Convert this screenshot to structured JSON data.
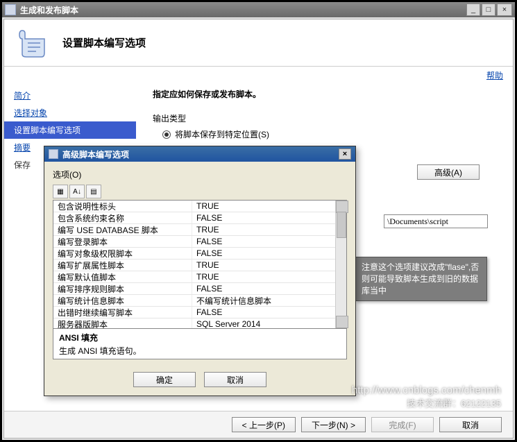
{
  "win": {
    "title": "生成和发布脚本",
    "min": "_",
    "max": "□",
    "close": "×"
  },
  "header": {
    "title": "设置脚本编写选项"
  },
  "help": "帮助",
  "sidebar": [
    {
      "label": "简介",
      "selected": false,
      "link": true
    },
    {
      "label": "选择对象",
      "selected": false,
      "link": true
    },
    {
      "label": "设置脚本编写选项",
      "selected": true,
      "link": false
    },
    {
      "label": "摘要",
      "selected": false,
      "link": true
    },
    {
      "label": "保存",
      "selected": false,
      "link": false,
      "plain": true
    }
  ],
  "main": {
    "head": "指定应如何保存或发布脚本。",
    "output_type_label": "输出类型",
    "radio1": "将脚本保存到特定位置(S)",
    "advanced_btn": "高级(A)",
    "path_value": "\\Documents\\script"
  },
  "footer": {
    "prev": "< 上一步(P)",
    "next": "下一步(N) >",
    "finish": "完成(F)",
    "cancel": "取消"
  },
  "dialog": {
    "title": "高级脚本编写选项",
    "opt_label": "选项(O)",
    "tools": [
      "▦",
      "A↓",
      "▤"
    ],
    "rows": [
      {
        "k": "包含说明性标头",
        "v": "TRUE"
      },
      {
        "k": "包含系统约束名称",
        "v": "FALSE"
      },
      {
        "k": "编写 USE DATABASE 脚本",
        "v": "TRUE"
      },
      {
        "k": "编写登录脚本",
        "v": "FALSE"
      },
      {
        "k": "编写对象级权限脚本",
        "v": "FALSE"
      },
      {
        "k": "编写扩展属性脚本",
        "v": "TRUE"
      },
      {
        "k": "编写默认值脚本",
        "v": "TRUE"
      },
      {
        "k": "编写排序规则脚本",
        "v": "FALSE"
      },
      {
        "k": "编写统计信息脚本",
        "v": "不编写统计信息脚本"
      },
      {
        "k": "出错时继续编写脚本",
        "v": "FALSE"
      },
      {
        "k": "服务器版脚本",
        "v": "SQL Server 2014"
      }
    ],
    "info_title": "ANSI 填充",
    "info_desc": "生成 ANSI 填充语句。",
    "ok": "确定",
    "cancel": "取消"
  },
  "tooltip": "注意这个选项建议改成\"flase\",否则可能导致脚本生成到旧的数据库当中",
  "watermark": {
    "url": "http://www.cnblogs.com/chenmh",
    "tag": "技术交流群：62122135"
  }
}
